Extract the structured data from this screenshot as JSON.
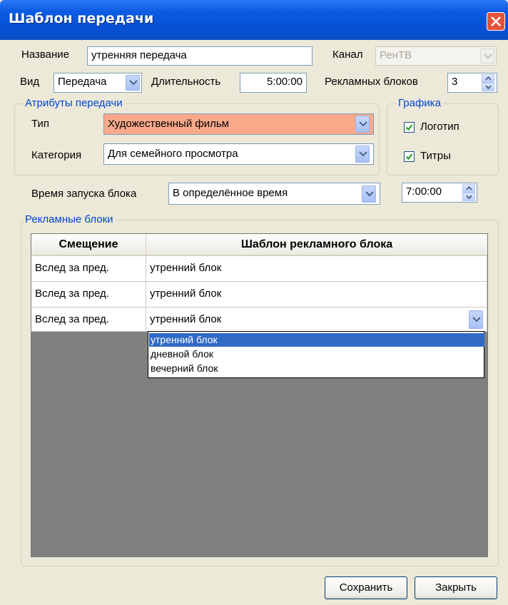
{
  "window": {
    "title": "Шаблон передачи"
  },
  "fields": {
    "name_label": "Название",
    "name_value": "утренняя передача",
    "channel_label": "Канал",
    "channel_value": "РенТВ",
    "type_label": "Вид",
    "type_value": "Передача",
    "duration_label": "Длительность",
    "duration_value": "5:00:00",
    "ad_blocks_label": "Рекламных блоков",
    "ad_blocks_value": "3"
  },
  "attributes": {
    "title": "Атрибуты передачи",
    "kind_label": "Тип",
    "kind_value": "Художественный фильм",
    "kind_highlight_color": "#f9a98a",
    "category_label": "Категория",
    "category_value": "Для семейного просмотра"
  },
  "graphics": {
    "title": "Графика",
    "logo_label": "Логотип",
    "logo_checked": true,
    "credits_label": "Титры",
    "credits_checked": true
  },
  "launch": {
    "label": "Время запуска блока",
    "mode_value": "В определённое время",
    "time_value": "7:00:00"
  },
  "ad_blocks": {
    "title": "Рекламные блоки",
    "columns": [
      "Смещение",
      "Шаблон рекламного блока"
    ],
    "rows": [
      {
        "offset": "Вслед за пред.",
        "template": "утренний блок"
      },
      {
        "offset": "Вслед за пред.",
        "template": "утренний блок"
      },
      {
        "offset": "Вслед за пред.",
        "template": "утренний блок"
      }
    ],
    "dropdown_options": [
      "утренний блок",
      "дневной блок",
      "вечерний блок"
    ],
    "dropdown_selected_index": 0
  },
  "buttons": {
    "save": "Сохранить",
    "close": "Закрыть"
  },
  "colors": {
    "title_bar": "#0a5be3",
    "group_title": "#0046d5",
    "selection": "#316ac5",
    "grid_empty": "#808080"
  }
}
